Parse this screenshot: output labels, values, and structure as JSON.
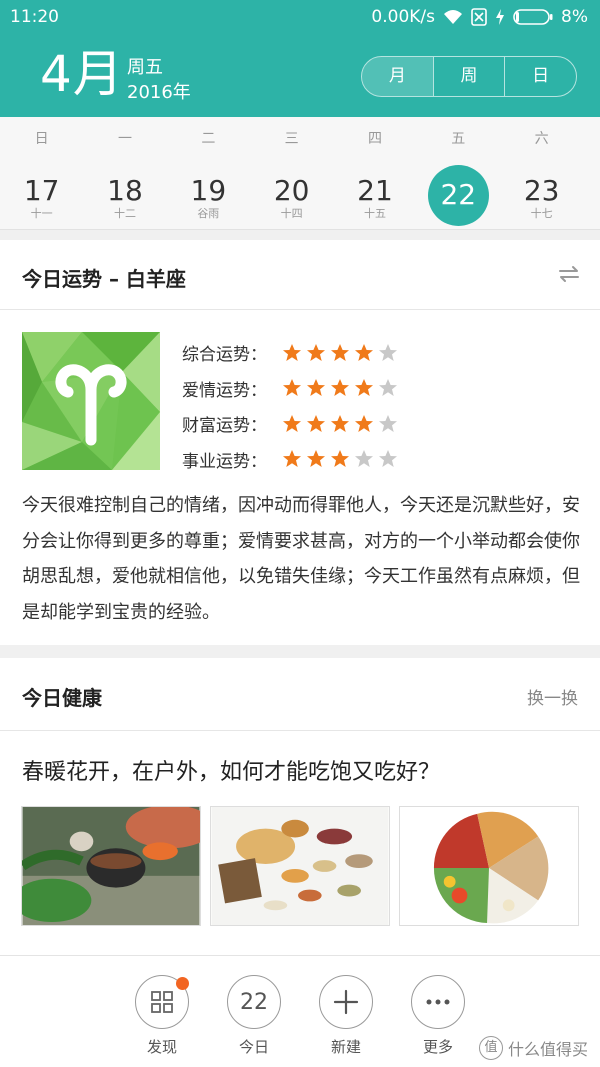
{
  "status_bar": {
    "time": "11:20",
    "network_speed": "0.00K/s",
    "battery": "8%"
  },
  "header": {
    "month": "4月",
    "weekday": "周五",
    "year": "2016年",
    "view_tabs": [
      "月",
      "周",
      "日"
    ],
    "selected_view": "月",
    "colors": {
      "accent": "#2db3a7"
    }
  },
  "week": {
    "weekday_labels": [
      "日",
      "一",
      "二",
      "三",
      "四",
      "五",
      "六"
    ],
    "days": [
      {
        "date": "17",
        "lunar": "十一"
      },
      {
        "date": "18",
        "lunar": "十二"
      },
      {
        "date": "19",
        "lunar": "谷雨"
      },
      {
        "date": "20",
        "lunar": "十四"
      },
      {
        "date": "21",
        "lunar": "十五"
      },
      {
        "date": "22",
        "lunar": ""
      },
      {
        "date": "23",
        "lunar": "十七"
      }
    ],
    "selected_date": "22"
  },
  "fortune": {
    "title": "今日运势 – 白羊座",
    "swap_icon": "swap-arrows-icon",
    "ratings": [
      {
        "label": "综合运势：",
        "stars": 4,
        "max": 5
      },
      {
        "label": "爱情运势：",
        "stars": 4,
        "max": 5
      },
      {
        "label": "财富运势：",
        "stars": 4,
        "max": 5
      },
      {
        "label": "事业运势：",
        "stars": 3,
        "max": 5
      }
    ],
    "text": "今天很难控制自己的情绪，因冲动而得罪他人，今天还是沉默些好，安分会让你得到更多的尊重；爱情要求甚高，对方的一个小举动都会使你胡思乱想，爱他就相信他，以免错失佳缘；今天工作虽然有点麻烦，但是却能学到宝贵的经验。",
    "colors": {
      "star_on": "#f07a1a",
      "star_off": "#c8c8c8"
    }
  },
  "health": {
    "title": "今日健康",
    "refresh_label": "换一换",
    "headline": "春暖花开，在户外，如何才能吃饱又吃好？"
  },
  "bottom_nav": [
    {
      "label": "发现",
      "icon": "grid-icon"
    },
    {
      "label": "今日",
      "icon": "today-date-icon",
      "value": "22"
    },
    {
      "label": "新建",
      "icon": "plus-icon"
    },
    {
      "label": "更多",
      "icon": "more-dots-icon"
    }
  ],
  "watermark": {
    "logo": "值",
    "text": "什么值得买"
  }
}
